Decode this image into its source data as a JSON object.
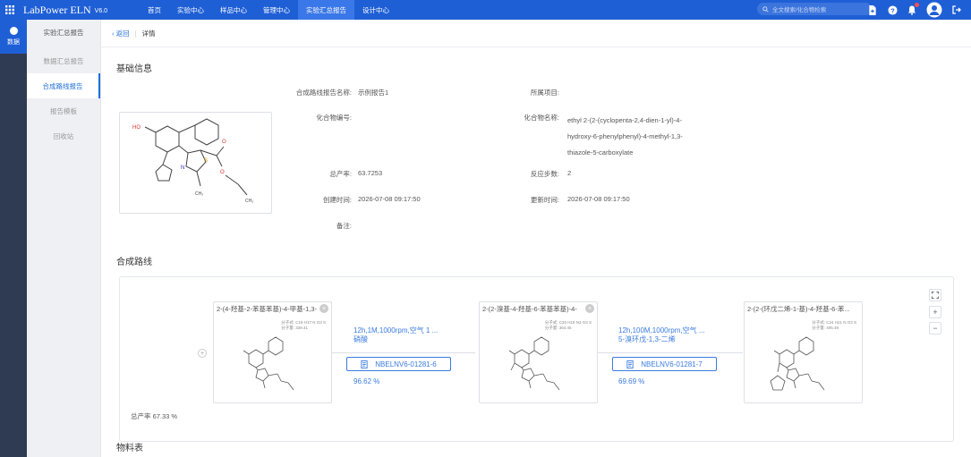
{
  "app": {
    "logo_text": "LabPower ELN",
    "version": "V6.0"
  },
  "nav": [
    "首页",
    "实验中心",
    "样品中心",
    "管理中心",
    "实验汇总报告",
    "设计中心"
  ],
  "search": {
    "placeholder": "全文搜索/化合物检索"
  },
  "rail": {
    "label": "数据"
  },
  "sidebar": {
    "head": "实验汇总报告",
    "items": [
      "数据汇总报告",
      "合成路线报告",
      "报告模板",
      "回收站"
    ]
  },
  "breadcrumb": {
    "back": "返回",
    "current": "详情"
  },
  "basic": {
    "section_title": "基础信息",
    "report_name_label": "合成路线报告名称:",
    "report_name": "示例报告1",
    "project_label": "所属项目:",
    "project": "",
    "compound_no_label": "化合物编号:",
    "compound_no": "",
    "compound_name_label": "化合物名称:",
    "compound_name_lines": [
      "ethyl 2-(2-(cyclopenta-2,4-dien-1-yl)-4-",
      "hydroxy-6-phenylphenyl)-4-methyl-1,3-",
      "thiazole-5-carboxylate"
    ],
    "total_yield_label": "总产率:",
    "total_yield": "63.7253",
    "steps_label": "反应步数:",
    "steps": "2",
    "created_label": "创建时间:",
    "created": "2026-07-08 09:17:50",
    "updated_label": "更新时间:",
    "updated": "2026-07-08 09:17:50",
    "note_label": "备注:",
    "note": ""
  },
  "route": {
    "section_title": "合成路线",
    "total_yield_text": "总产率 67.33 %",
    "cards": [
      {
        "title": "2-(4-羟基-2-苯基苯基)-4-甲基-1,3-",
        "meta": [
          "分子式: C19 H17 N O3 S",
          "分子量: 339.41"
        ]
      },
      {
        "title": "2-(2-溴基-4-羟基-6-苯基苯基)-4-",
        "meta": [
          "分子式: C20 H18 N3 O3 S",
          "分子量: 364.45"
        ]
      },
      {
        "title": "2-(2-(环戊二烯-1-基)-4-羟基-6-苯...",
        "meta": [
          "分子式: C24 H21 N O3 S",
          "分子量: 405.49"
        ]
      }
    ],
    "steps": [
      {
        "cond_line1": "12h,1M,1000rpm,空气 1 ...",
        "cond_line2": "硝酸",
        "nb": "NBELNV6-01281-6",
        "yield": "96.62 %"
      },
      {
        "cond_line1": "12h,100M,1000rpm,空气 ...",
        "cond_line2": "5-溴环戊-1,3-二烯",
        "nb": "NBELNV6-01281-7",
        "yield": "69.69 %"
      }
    ]
  },
  "materials": {
    "section_title": "物料表"
  },
  "colors": {
    "primary": "#1f5fd6",
    "accent": "#3a7be0"
  }
}
